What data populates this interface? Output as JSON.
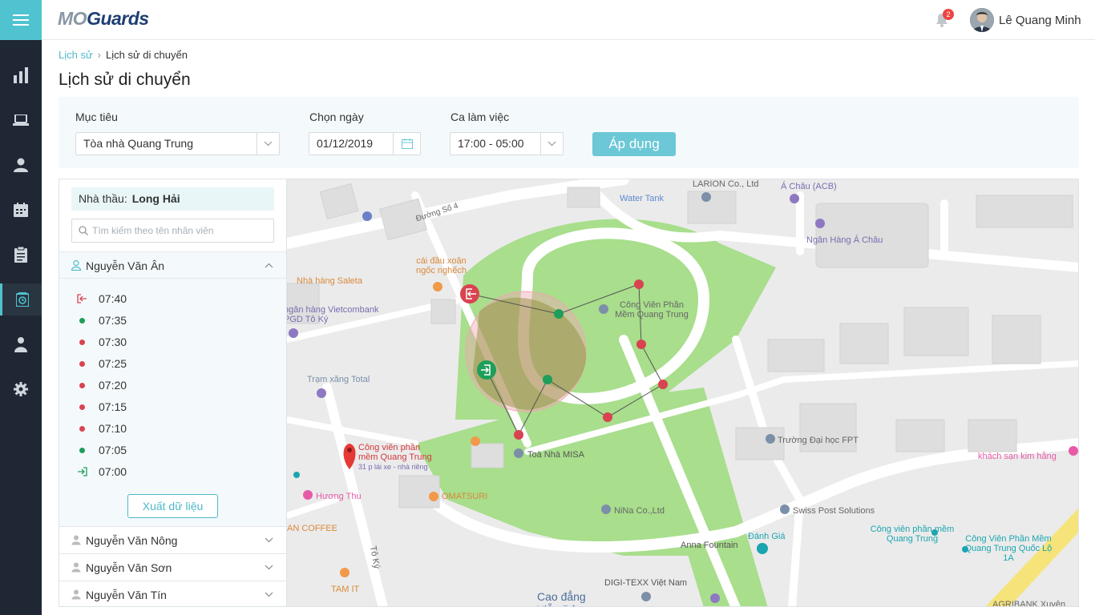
{
  "app": {
    "logo_prefix": "MO",
    "logo_suffix": "Guards"
  },
  "header": {
    "notification_count": "2",
    "user_name": "Lê Quang Minh"
  },
  "breadcrumb": {
    "parent": "Lịch sử",
    "current": "Lịch sử di chuyển"
  },
  "page": {
    "title": "Lịch sử di chuyển"
  },
  "filters": {
    "target_label": "Mục tiêu",
    "target_value": "Tòa nhà Quang Trung",
    "date_label": "Chọn ngày",
    "date_value": "01/12/2019",
    "shift_label": "Ca làm việc",
    "shift_value": "17:00 - 05:00",
    "apply_label": "Áp dụng"
  },
  "panel": {
    "contractor_label": "Nhà thầu:",
    "contractor_value": "Long Hải",
    "search_placeholder": "Tìm kiếm theo tên nhân viên",
    "export_label": "Xuất dữ liệu",
    "employees": [
      {
        "name": "Nguyễn Văn Ân",
        "expanded": true
      },
      {
        "name": "Nguyễn Văn Nông",
        "expanded": false
      },
      {
        "name": "Nguyễn Văn Sơn",
        "expanded": false
      },
      {
        "name": "Nguyễn Văn Tín",
        "expanded": false
      }
    ],
    "timeline": [
      {
        "time": "07:40",
        "type": "check-out"
      },
      {
        "time": "07:35",
        "type": "green"
      },
      {
        "time": "07:30",
        "type": "red"
      },
      {
        "time": "07:25",
        "type": "red"
      },
      {
        "time": "07:20",
        "type": "red"
      },
      {
        "time": "07:15",
        "type": "red"
      },
      {
        "time": "07:10",
        "type": "red"
      },
      {
        "time": "07:05",
        "type": "green"
      },
      {
        "time": "07:00",
        "type": "check-in"
      }
    ]
  },
  "map": {
    "labels": [
      "Water Tank",
      "LARION Co., Ltd",
      "Á Châu (ACB)",
      "Ngân Hàng Á Châu",
      "Đường Số 4",
      "cái đầu xoăn ngốc nghếch",
      "Nhà hàng Saleta",
      "ngân hàng Vietcombank PGD Tô Ký",
      "Công Viên Phần Mềm Quang Trung",
      "Trạm xăng Total",
      "Trường Đại học FPT",
      "khách sạn kim hằng",
      "Toà Nhà MISA",
      "Công viên phần mềm Quang Trung",
      "31 p lái xe - nhà riêng",
      "Hương Thu",
      "OMATSURI",
      "NiNa Co.,Ltd",
      "Swiss Post Solutions",
      "Đánh Giá",
      "Anna Fountain",
      "AN COFFEE",
      "Tô Ký",
      "TAM IT",
      "DIGI-TEXX Việt Nam",
      "Cao đẳng Viễn Đông",
      "Công Viên Phần Mềm Quang Trung Quốc Lộ 1A",
      "AGRIBANK Xuyên"
    ]
  },
  "colors": {
    "accent": "#4fc3d0",
    "sidebar": "#1e2733",
    "route_red": "#d9434f",
    "route_green": "#1e9e5a",
    "park": "#a8de8c"
  }
}
